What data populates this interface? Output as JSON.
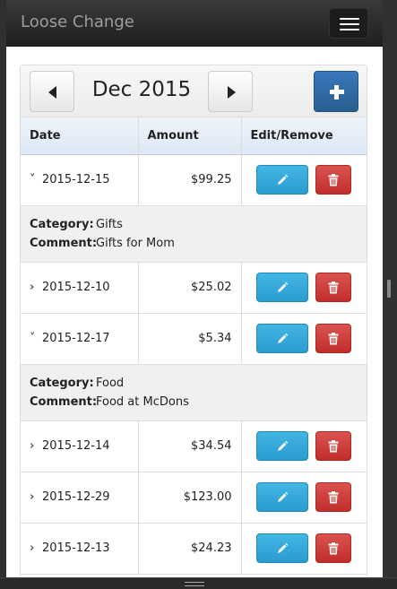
{
  "app": {
    "title": "Loose Change"
  },
  "month": {
    "label": "Dec 2015"
  },
  "table": {
    "headers": [
      "Date",
      "Amount",
      "Edit/Remove"
    ],
    "category_label": "Category:",
    "comment_label": "Comment:",
    "rows": [
      {
        "date": "2015-12-15",
        "amount": "$99.25",
        "expanded": true,
        "category": "Gifts",
        "comment": "Gifts for Mom"
      },
      {
        "date": "2015-12-10",
        "amount": "$25.02",
        "expanded": false
      },
      {
        "date": "2015-12-17",
        "amount": "$5.34",
        "expanded": true,
        "category": "Food",
        "comment": "Food at McDons"
      },
      {
        "date": "2015-12-14",
        "amount": "$34.54",
        "expanded": false
      },
      {
        "date": "2015-12-29",
        "amount": "$123.00",
        "expanded": false
      },
      {
        "date": "2015-12-13",
        "amount": "$24.23",
        "expanded": false
      }
    ]
  },
  "icons": {
    "prev": "triangle-left-icon",
    "next": "triangle-right-icon",
    "add": "plus-icon",
    "edit": "pencil-icon",
    "delete": "trash-icon",
    "expanded": "chevron-down-icon",
    "collapsed": "chevron-right-icon"
  },
  "colors": {
    "add": "#285e8e",
    "edit": "#2a9bd0",
    "delete": "#c12e2a",
    "navbar": "#222222"
  }
}
